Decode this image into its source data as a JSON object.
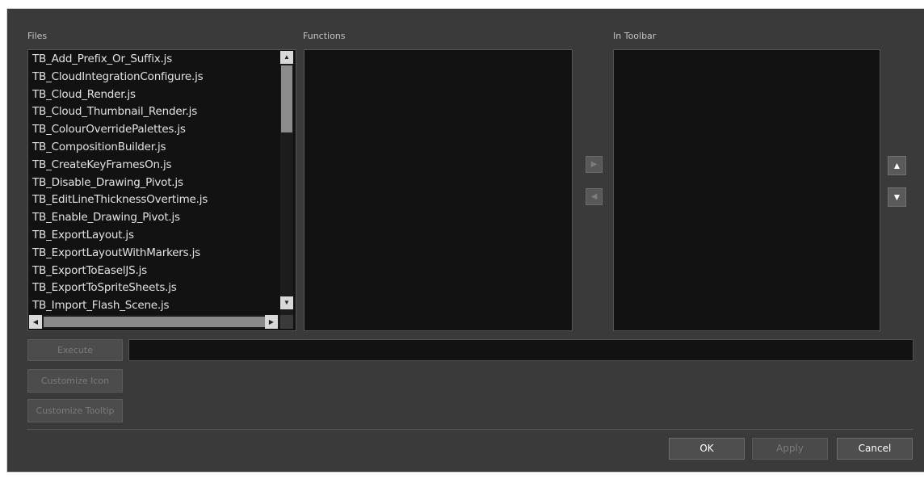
{
  "labels": {
    "files": "Files",
    "functions": "Functions",
    "in_toolbar": "In Toolbar"
  },
  "files": [
    "TB_Add_Prefix_Or_Suffix.js",
    "TB_CloudIntegrationConfigure.js",
    "TB_Cloud_Render.js",
    "TB_Cloud_Thumbnail_Render.js",
    "TB_ColourOverridePalettes.js",
    "TB_CompositionBuilder.js",
    "TB_CreateKeyFramesOn.js",
    "TB_Disable_Drawing_Pivot.js",
    "TB_EditLineThicknessOvertime.js",
    "TB_Enable_Drawing_Pivot.js",
    "TB_ExportLayout.js",
    "TB_ExportLayoutWithMarkers.js",
    "TB_ExportToEaselJS.js",
    "TB_ExportToSpriteSheets.js",
    "TB_Import_Flash_Scene.js"
  ],
  "buttons": {
    "add_arrow": "▶",
    "remove_arrow": "◀",
    "move_up": "▲",
    "move_down": "▼",
    "execute": "Execute",
    "customize_icon": "Customize Icon",
    "customize_tooltip": "Customize Tooltip",
    "ok": "OK",
    "apply": "Apply",
    "cancel": "Cancel"
  },
  "scroll_arrows": {
    "up": "▲",
    "down": "▼",
    "left": "◀",
    "right": "▶"
  },
  "execute_field_value": "",
  "colors": {
    "dialog_bg": "#3a3a3a",
    "panel_bg": "#121212",
    "text_enabled": "#ffffff",
    "text_disabled": "#7a7a7a"
  }
}
